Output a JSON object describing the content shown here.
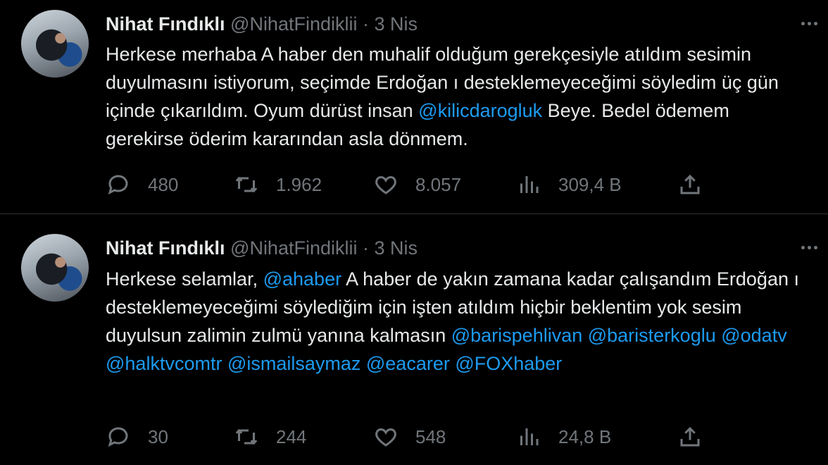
{
  "tweets": [
    {
      "name": "Nihat Fındıklı",
      "handle": "@NihatFindiklii",
      "separator": "·",
      "date": "3 Nis",
      "text_parts": [
        "Herkese  merhaba A haber den muhalif olduğum gerekçesiyle atıldım sesimin duyulmasını istiyorum, seçimde Erdoğan ı desteklemeyeceğimi söyledim üç gün içinde çıkarıldım. Oyum dürüst insan  ",
        "@kilicdarogluk",
        " Beye. Bedel ödemem gerekirse öderim kararından asla dönmem."
      ],
      "replies": "480",
      "retweets": "1.962",
      "likes": "8.057",
      "views": "309,4 B"
    },
    {
      "name": "Nihat Fındıklı",
      "handle": "@NihatFindiklii",
      "separator": "·",
      "date": "3 Nis",
      "text_parts": [
        "Herkese selamlar, ",
        "@ahaber",
        " A haber de yakın zamana kadar çalışandım Erdoğan ı desteklemeyeceğimi söylediğim için işten atıldım hiçbir beklentim yok sesim duyulsun zalimin zulmü yanına kalmasın ",
        "@barispehlivan @baristerkoglu @odatv @halktvcomtr @ismailsaymaz @eacarer @FOXhaber"
      ],
      "replies": "30",
      "retweets": "244",
      "likes": "548",
      "views": "24,8 B"
    }
  ],
  "icons": [
    "reply-icon",
    "retweet-icon",
    "like-icon",
    "views-icon",
    "share-icon",
    "more-icon"
  ],
  "colors": {
    "background": "#000000",
    "text": "#e7e9ea",
    "muted": "#71767b",
    "link": "#1d9bf0",
    "divider": "#2f3336"
  }
}
